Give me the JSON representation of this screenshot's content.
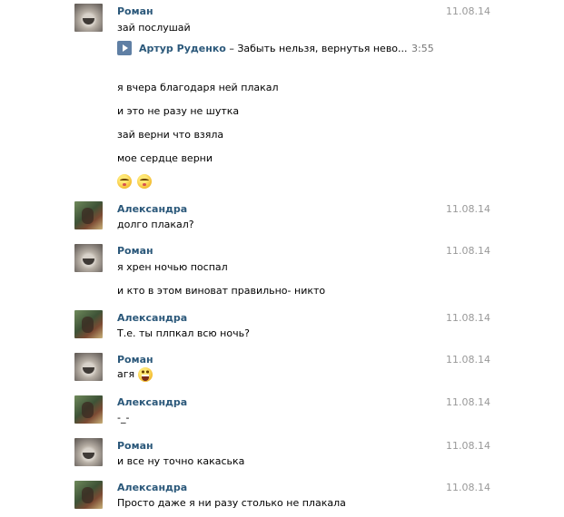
{
  "messages": [
    {
      "author": "Роман",
      "date": "11.08.14",
      "lines": [
        "зай послушай"
      ],
      "audio": {
        "artist": "Артур Руденко",
        "separator": " – ",
        "title": "Забыть нельзя, вернутья нево...",
        "duration": "3:55"
      },
      "extra_lines": [
        "я вчера благодаря ней плакал",
        "и это не разу не шутка",
        "зай верни что взяла",
        "мое сердце верни"
      ],
      "emoji": [
        "kissing-closed-eyes-icon",
        "kissing-closed-eyes-icon"
      ]
    },
    {
      "author": "Александра",
      "date": "11.08.14",
      "lines": [
        "долго плакал?"
      ]
    },
    {
      "author": "Роман",
      "date": "11.08.14",
      "lines": [
        "я хрен ночью поспал",
        "и кто в этом виноват правильно- никто"
      ]
    },
    {
      "author": "Александра",
      "date": "11.08.14",
      "lines": [
        "Т.е. ты плпкал всю ночь?"
      ]
    },
    {
      "author": "Роман",
      "date": "11.08.14",
      "lines": [
        "агя"
      ],
      "emoji": [
        "grinning-icon"
      ]
    },
    {
      "author": "Александра",
      "date": "11.08.14",
      "lines": [
        "-_-"
      ]
    },
    {
      "author": "Роман",
      "date": "11.08.14",
      "lines": [
        "и все ну точно какаська"
      ]
    },
    {
      "author": "Александра",
      "date": "11.08.14",
      "lines": [
        "Просто даже я ни разу столько не плакала"
      ]
    }
  ],
  "colors": {
    "author": "#2b587a",
    "date": "#999999",
    "play_button": "#5f7fa4"
  }
}
